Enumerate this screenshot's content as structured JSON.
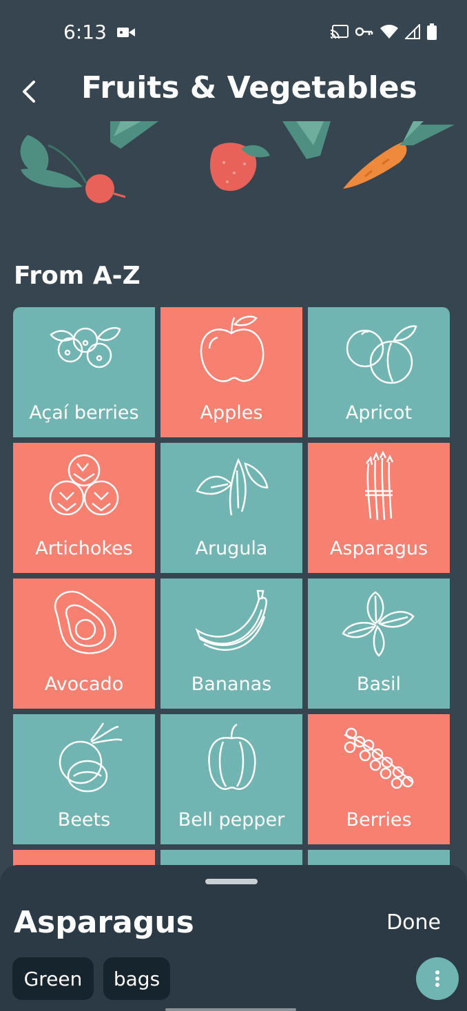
{
  "status": {
    "time": "6:13"
  },
  "header": {
    "title": "Fruits & Vegetables"
  },
  "section": {
    "title": "From A-Z"
  },
  "colors": {
    "teal": "#71b5b2",
    "coral": "#f88071",
    "background": "#36454f"
  },
  "tiles": [
    {
      "label": "Açaí berries",
      "color": "teal",
      "icon": "acai-berries-icon"
    },
    {
      "label": "Apples",
      "color": "coral",
      "icon": "apple-icon"
    },
    {
      "label": "Apricot",
      "color": "teal",
      "icon": "apricot-icon"
    },
    {
      "label": "Artichokes",
      "color": "coral",
      "icon": "artichoke-icon"
    },
    {
      "label": "Arugula",
      "color": "teal",
      "icon": "arugula-icon"
    },
    {
      "label": "Asparagus",
      "color": "coral",
      "icon": "asparagus-icon"
    },
    {
      "label": "Avocado",
      "color": "coral",
      "icon": "avocado-icon"
    },
    {
      "label": "Bananas",
      "color": "teal",
      "icon": "banana-icon"
    },
    {
      "label": "Basil",
      "color": "teal",
      "icon": "basil-icon"
    },
    {
      "label": "Beets",
      "color": "teal",
      "icon": "beet-icon"
    },
    {
      "label": "Bell pepper",
      "color": "teal",
      "icon": "bell-pepper-icon"
    },
    {
      "label": "Berries",
      "color": "coral",
      "icon": "berries-icon"
    }
  ],
  "sheet": {
    "title": "Asparagus",
    "done_label": "Done",
    "chips": [
      "Green",
      "bags"
    ]
  }
}
